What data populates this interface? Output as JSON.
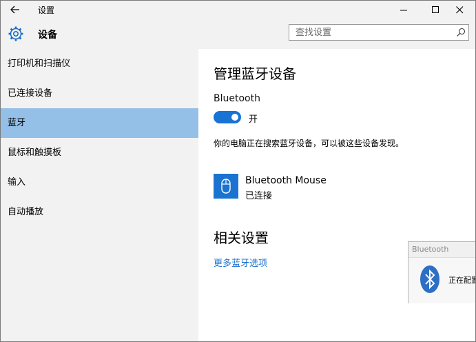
{
  "window": {
    "title": "设置",
    "controls": [
      "minimize",
      "maximize",
      "close"
    ]
  },
  "header": {
    "title": "设备",
    "search_placeholder": "查找设置"
  },
  "sidebar": {
    "items": [
      {
        "label": "打印机和扫描仪",
        "active": false
      },
      {
        "label": "已连接设备",
        "active": false
      },
      {
        "label": "蓝牙",
        "active": true
      },
      {
        "label": "鼠标和触摸板",
        "active": false
      },
      {
        "label": "输入",
        "active": false
      },
      {
        "label": "自动播放",
        "active": false
      }
    ]
  },
  "main": {
    "heading": "管理蓝牙设备",
    "bluetooth_label": "Bluetooth",
    "toggle_state": "开",
    "toggle_on": true,
    "description": "你的电脑正在搜索蓝牙设备，可以被这些设备发现。",
    "devices": [
      {
        "name": "Bluetooth Mouse",
        "status": "已连接",
        "icon": "mouse-icon"
      }
    ],
    "related_heading": "相关设置",
    "more_link": "更多蓝牙选项"
  },
  "popup": {
    "title": "Bluetooth",
    "text": "正在配置",
    "icon": "bluetooth-icon"
  },
  "colors": {
    "accent": "#1873d3",
    "selected_nav": "#94bfe6",
    "link": "#1a6fcc",
    "panel_bg": "#f2f2f2"
  }
}
